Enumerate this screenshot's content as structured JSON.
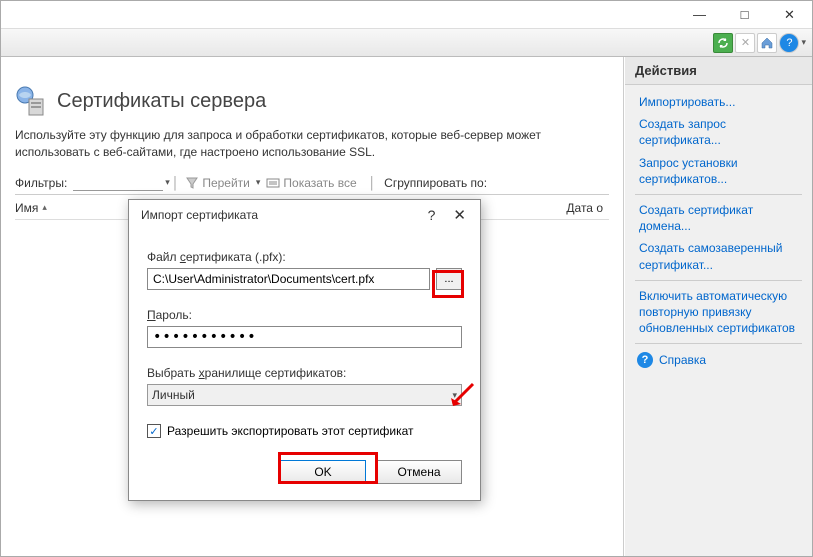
{
  "window": {
    "minimize": "—",
    "maximize": "□",
    "close": "✕"
  },
  "page": {
    "title": "Сертификаты сервера",
    "description": "Используйте эту функцию для запроса и обработки сертификатов, которые веб-сервер может использовать с веб-сайтами, где настроено использование SSL."
  },
  "filter_bar": {
    "label": "Фильтры:",
    "go": "Перейти",
    "show_all": "Показать все",
    "group_by": "Сгруппировать по:"
  },
  "columns": {
    "name": "Имя",
    "date": "Дата о"
  },
  "actions": {
    "header": "Действия",
    "import": "Импортировать...",
    "create_request": "Создать запрос сертификата...",
    "install_request": "Запрос установки сертификатов...",
    "create_domain": "Создать сертификат домена...",
    "create_selfsigned": "Создать самозаверенный сертификат...",
    "auto_rebind": "Включить автоматическую повторную привязку обновленных сертификатов",
    "help": "Справка"
  },
  "dialog": {
    "title": "Импорт сертификата",
    "file_label_prefix": "Файл ",
    "file_label_ul": "с",
    "file_label_suffix": "ертификата (.pfx):",
    "file_value": "C:\\User\\Administrator\\Documents\\cert.pfx",
    "browse": "...",
    "password_label_prefix": "",
    "password_label_ul": "П",
    "password_label_suffix": "ароль:",
    "password_mask": "•••••••••••",
    "store_label_prefix": "Выбрать ",
    "store_label_ul": "х",
    "store_label_suffix": "ранилище сертификатов:",
    "store_value": "Личный",
    "allow_export_prefix": "Разрешить ",
    "allow_export_ul": "э",
    "allow_export_suffix": "кспортировать этот сертификат",
    "ok": "OK",
    "cancel": "Отмена",
    "help": "?",
    "close": "✕"
  }
}
